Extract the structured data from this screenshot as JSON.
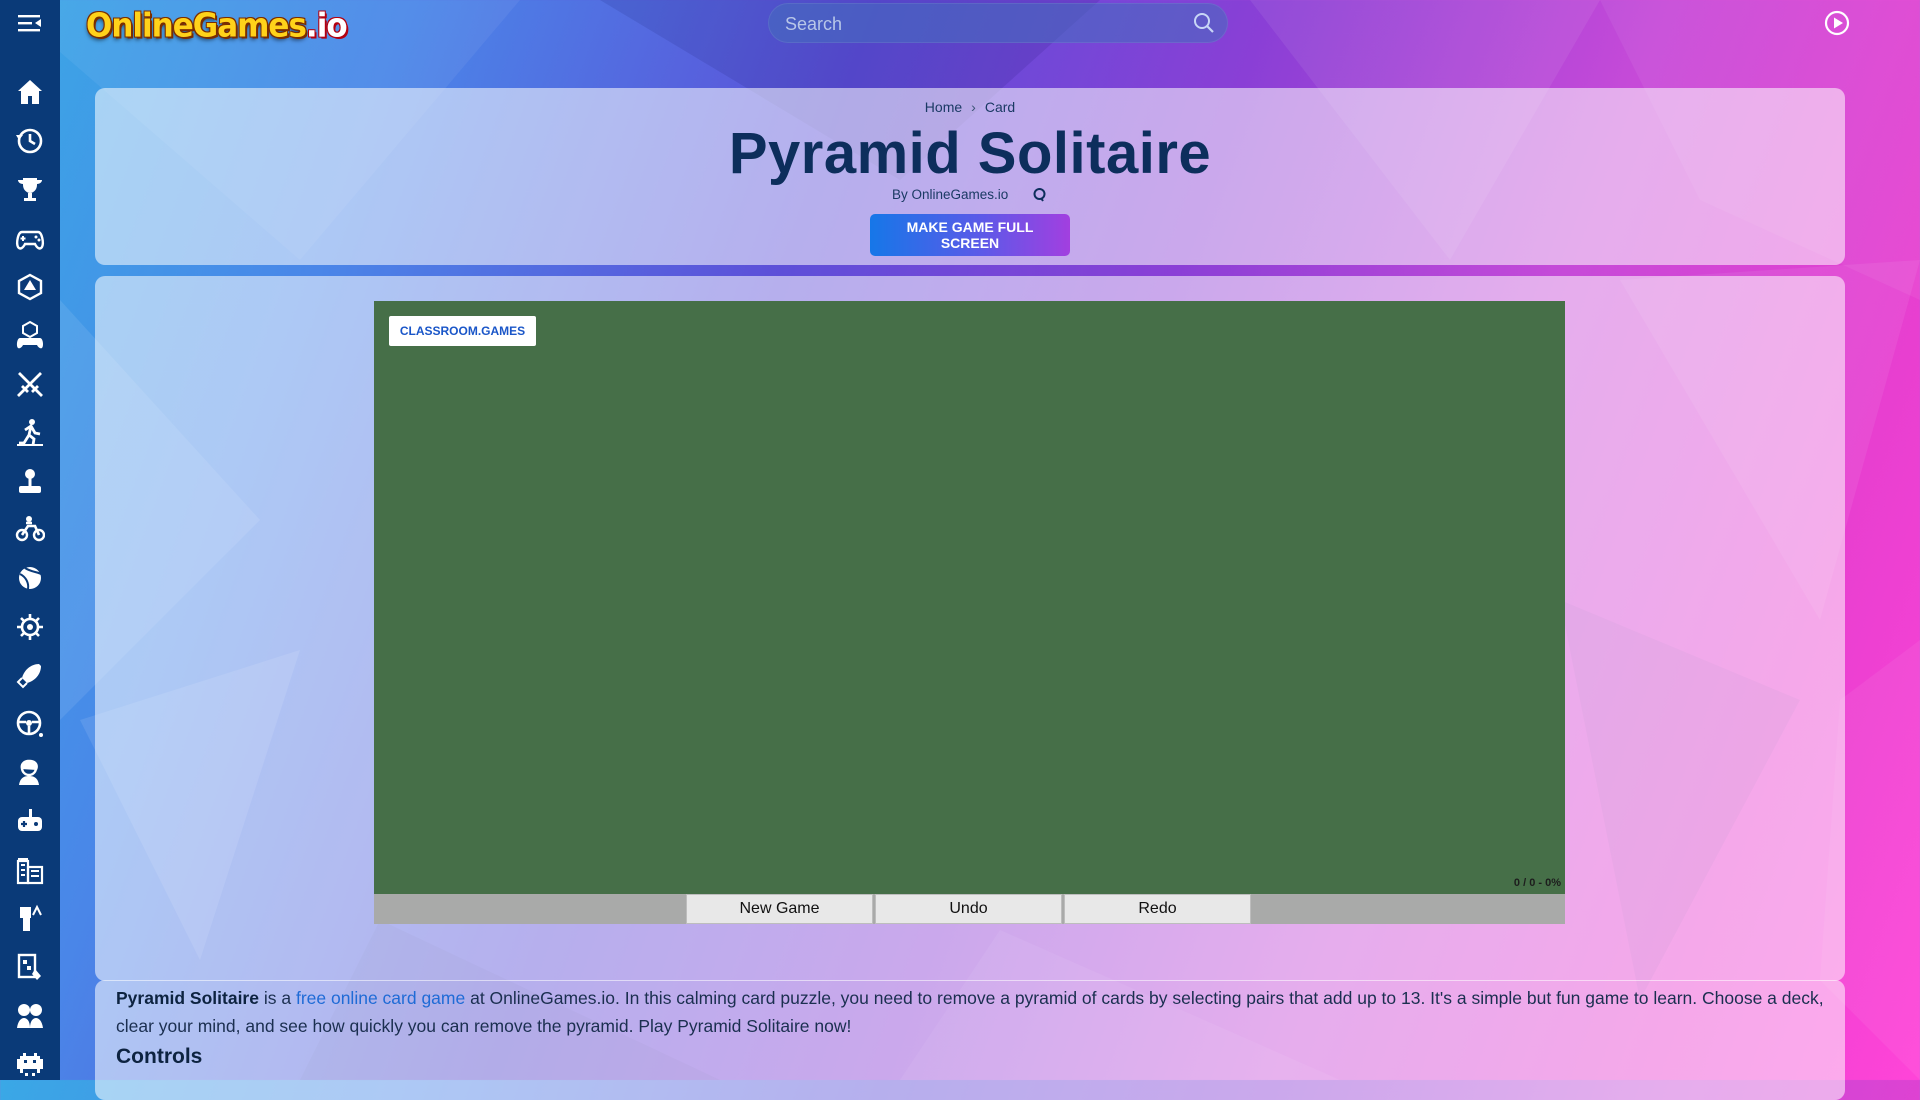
{
  "header": {
    "logo_main": "OnlineGames",
    "logo_suffix": ".io",
    "search_placeholder": "Search",
    "menu_icon": "menu-icon",
    "play_icon": "play-circle-icon"
  },
  "sidebar": {
    "items": [
      {
        "name": "home",
        "icon": "home-icon"
      },
      {
        "name": "recent",
        "icon": "history-icon"
      },
      {
        "name": "popular",
        "icon": "trophy-icon"
      },
      {
        "name": "controller",
        "icon": "gamepad-icon"
      },
      {
        "name": "3d",
        "icon": "d20-icon"
      },
      {
        "name": "io",
        "icon": "cube-gamepad-icon"
      },
      {
        "name": "action",
        "icon": "swords-icon"
      },
      {
        "name": "skill",
        "icon": "runner-icon"
      },
      {
        "name": "arcade",
        "icon": "joystick-icon"
      },
      {
        "name": "bike",
        "icon": "motorbike-icon"
      },
      {
        "name": "sports",
        "icon": "ball-icon"
      },
      {
        "name": "puzzle",
        "icon": "gear-brain-icon"
      },
      {
        "name": "shooting",
        "icon": "rocket-icon"
      },
      {
        "name": "driving",
        "icon": "steering-wheel-icon"
      },
      {
        "name": "girls",
        "icon": "girl-icon"
      },
      {
        "name": "multiplayer",
        "icon": "controller-plus-icon"
      },
      {
        "name": "building",
        "icon": "city-icon"
      },
      {
        "name": "minecraft",
        "icon": "blocky-icon"
      },
      {
        "name": "board",
        "icon": "board-game-icon"
      },
      {
        "name": "two-player",
        "icon": "two-people-icon"
      },
      {
        "name": "retro",
        "icon": "space-invader-icon"
      }
    ]
  },
  "title_panel": {
    "breadcrumb": [
      "Home",
      "Card"
    ],
    "breadcrumb_separator": "›",
    "title": "Pyramid Solitaire",
    "byline": "By OnlineGames.io",
    "fullscreen_button": "MAKE GAME FULL SCREEN"
  },
  "game": {
    "classroom_button": "CLASSROOM.GAMES",
    "score": "0 / 0 - 0%",
    "controls": [
      "New Game",
      "Undo",
      "Redo"
    ],
    "felt_color": "#466f48"
  },
  "description": {
    "game_name": "Pyramid Solitaire",
    "part1": " is a ",
    "link_text": "free online card game",
    "part2": " at OnlineGames.io. In this calming card puzzle, you need to remove a pyramid of cards by selecting pairs that add up to 13. It's a simple but fun game to learn. Choose a deck, clear your mind, and see how quickly you can remove the pyramid. Play Pyramid Solitaire now!",
    "controls_heading": "Controls"
  },
  "colors": {
    "sidebar": "#0a3a78",
    "title_text": "#0d2e5c",
    "link": "#1f6bd6"
  }
}
